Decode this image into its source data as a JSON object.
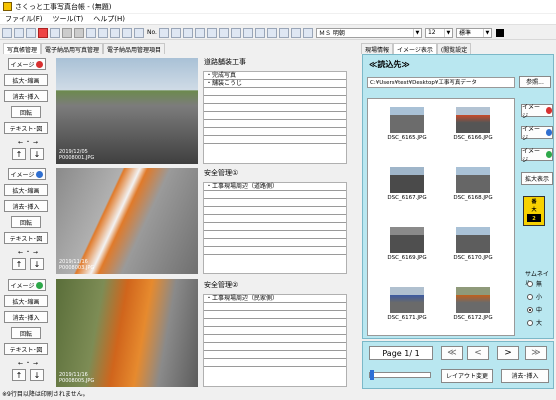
{
  "window": {
    "title": "さくっと工事写真台帳 - (無題)"
  },
  "menu": [
    "ファイル(F)",
    "ツール(T)",
    "ヘルプ(H)"
  ],
  "toolbar": {
    "font": "ＭＳ 明朝",
    "size": "12",
    "style": "標準",
    "no_label": "No."
  },
  "left_tabs": [
    "写真帳管理",
    "電子納品用写真管理",
    "電子納品用管理項目"
  ],
  "left_buttons": {
    "image": "イメージ",
    "expand": "拡大･縮画",
    "delete": "消去･挿入",
    "rotate": "回転",
    "text": "テキスト･図",
    "arrows_label": "← ・ →",
    "up": "↑",
    "down": "↓"
  },
  "rows": [
    {
      "dot_color": "#d83030",
      "date": "2019/12/05",
      "id": "P0008001.JPG",
      "title": "道路舗装工事",
      "lines": [
        "・完成写真",
        "・舗装こうじ",
        "",
        "",
        "",
        "",
        "",
        "",
        ""
      ]
    },
    {
      "dot_color": "#2f6fd0",
      "date": "2019/11/16",
      "id": "P0008003.JPG",
      "title": "安全管理①",
      "lines": [
        "・工事現場周辺（道路側）",
        "",
        "",
        "",
        "",
        "",
        "",
        "",
        ""
      ]
    },
    {
      "dot_color": "#2ea84a",
      "date": "2019/11/16",
      "id": "P0008005.JPG",
      "title": "安全管理②",
      "lines": [
        "・工事現場周辺（民家側）",
        "",
        "",
        "",
        "",
        "",
        "",
        "",
        ""
      ]
    }
  ],
  "right_tabs": [
    "現場情報",
    "イメージ表示",
    "(閲覧設定"
  ],
  "right": {
    "title": "≪読込先≫",
    "path": "C:¥Users¥test¥Desktop¥工事写真データ",
    "ref_button": "参照...",
    "thumbs": [
      "DSC_6165.JPG",
      "DSC_6166.JPG",
      "DSC_6167.JPG",
      "DSC_6168.JPG",
      "DSC_6169.JPG",
      "DSC_6170.JPG",
      "DSC_6171.JPG",
      "DSC_6172.JPG"
    ],
    "img_btn": "イメージ",
    "zoom_btn": "拡大表示",
    "warn_top": "番",
    "warn_mid": "大",
    "warn_bot": "2",
    "size_label": "サムネイル",
    "sizes": [
      "無",
      "小",
      "中",
      "大"
    ],
    "size_selected": "中"
  },
  "bottom": {
    "page": "Page 1/ 1",
    "nav": [
      "≪",
      "<",
      ">",
      "≫"
    ],
    "layout": "レイアウト変更",
    "delins": "消去･挿入"
  },
  "status": "※9行目以降は印刷されません。"
}
